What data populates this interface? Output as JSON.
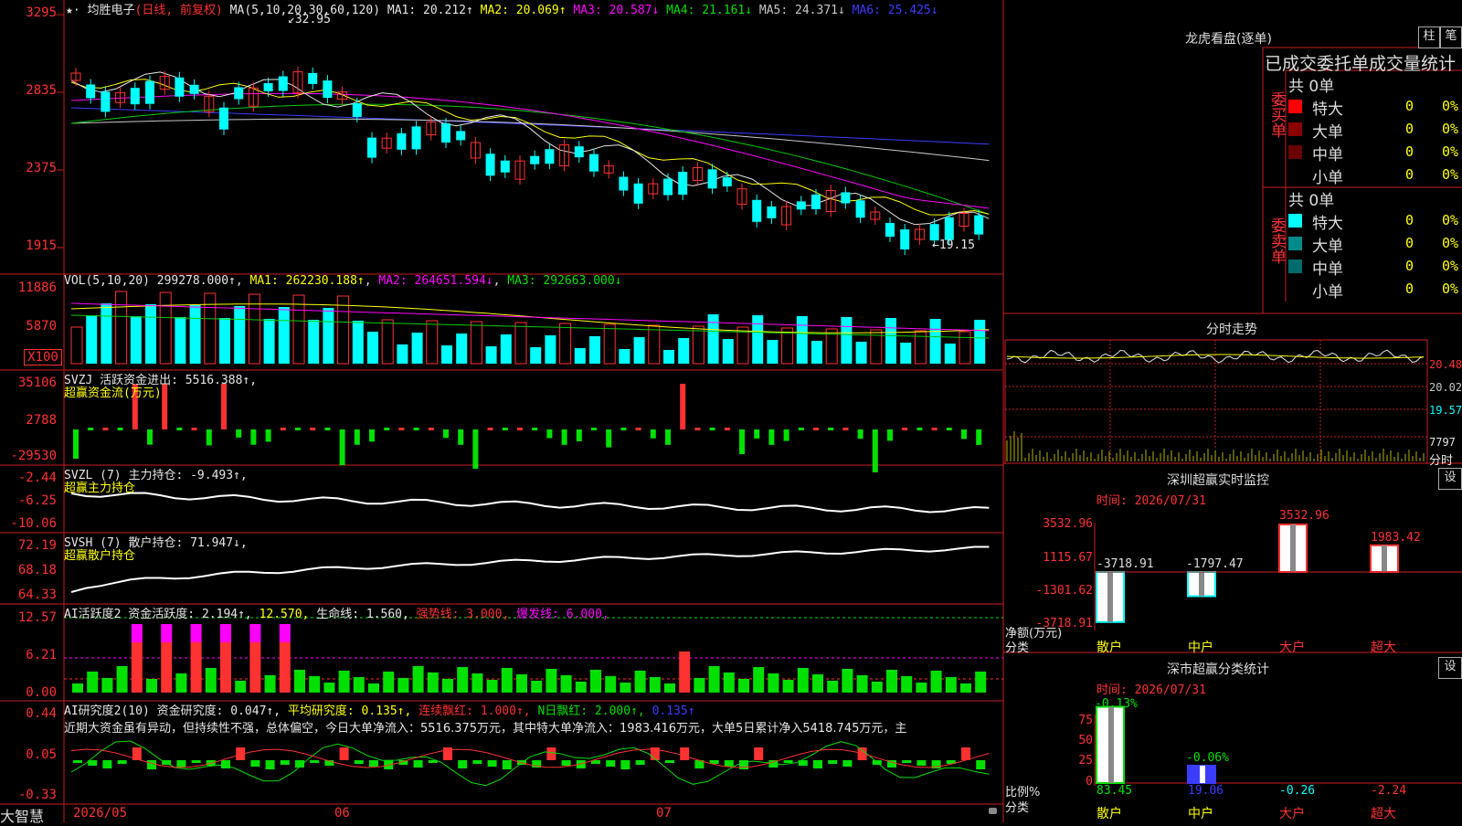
{
  "stock": {
    "name": "均胜电子",
    "period": "日线",
    "adjust": "前复权",
    "ma_label": "MA(5,10,20,30,60,120)",
    "ma1": "MA1: 20.212↑",
    "ma2": "MA2: 20.069↑",
    "ma3": "MA3: 20.587↓",
    "ma4": "MA4: 21.161↓",
    "ma5": "MA5: 24.371↓",
    "ma6": "MA6: 25.425↓",
    "high_mark": "32.95",
    "low_mark": "←19.15",
    "price_axis": [
      "3295",
      "2835",
      "2375",
      "1915"
    ]
  },
  "vol": {
    "label": "VOL(5,10,20)",
    "value": "299278.000↑",
    "ma1": "MA1: 262230.188↑",
    "ma2": "MA2: 264651.594↓",
    "ma3": "MA3: 292663.000↓",
    "axis": [
      "11886",
      "5870",
      "X100"
    ]
  },
  "svzj": {
    "label": "SVZJ  活跃资金进出: 5516.388↑,",
    "sub": "超赢资金流(万元)",
    "axis": [
      "35106",
      "2788",
      "-29530"
    ]
  },
  "svzl": {
    "label": "SVZL (7) 主力持仓: -9.493↑,",
    "sub": "超赢主力持仓",
    "axis": [
      "-2.44",
      "-6.25",
      "-10.06"
    ]
  },
  "svsh": {
    "label": "SVSH (7) 散户持仓: 71.947↓,",
    "sub": "超赢散户持仓",
    "axis": [
      "72.19",
      "68.18",
      "64.33"
    ]
  },
  "ai_active": {
    "label": "AI活跃度2 资金活跃度: 2.194↑,",
    "v1": "12.570,",
    "v2": "生命线: 1.560,",
    "v3": "强势线: 3.000,",
    "v4": "爆发线: 6.000,",
    "axis": [
      "12.57",
      "6.21",
      "0.00"
    ]
  },
  "ai_research": {
    "label": "AI研究度2(10) 资金研究度: 0.047↑,",
    "v1": "平均研究度: 0.135↑,",
    "v2": "连续飘红: 1.000↑,",
    "v3": "N日飘红: 2.000↑,",
    "v4": "0.135↑",
    "comment": "近期大资金虽有异动，但持续性不强，总体偏空，今日大单净流入：5516.375万元，其中特大单净流入：1983.416万元，大单5日累计净入5418.745万元，主",
    "axis": [
      "0.44",
      "0.05",
      "-0.33"
    ]
  },
  "date_axis": [
    "2026/05",
    "06",
    "07"
  ],
  "brand": "大智慧",
  "right": {
    "lhkp_title": "龙虎看盘(逐单)",
    "btn_zhu": "柱",
    "btn_bi": "笔",
    "lhkp_header": "已成交委托单成交量统计",
    "buy_side": "委买单",
    "sell_side": "委卖单",
    "buy_total": "共 0单",
    "sell_total": "共 0单",
    "buy_rows": [
      {
        "label": "特大",
        "count": "0",
        "pct": "0%",
        "color": "#ff0000"
      },
      {
        "label": "大单",
        "count": "0",
        "pct": "0%",
        "color": "#8b0000"
      },
      {
        "label": "中单",
        "count": "0",
        "pct": "0%",
        "color": "#6b0000"
      },
      {
        "label": "小单",
        "count": "0",
        "pct": "0%",
        "color": "#000000"
      }
    ],
    "sell_rows": [
      {
        "label": "特大",
        "count": "0",
        "pct": "0%",
        "color": "#00ffff"
      },
      {
        "label": "大单",
        "count": "0",
        "pct": "0%",
        "color": "#008b8b"
      },
      {
        "label": "中单",
        "count": "0",
        "pct": "0%",
        "color": "#006b6b"
      },
      {
        "label": "小单",
        "count": "0",
        "pct": "0%",
        "color": "#000000"
      }
    ],
    "fenshi_title": "分时走势",
    "fenshi_axis": [
      "20.48",
      "20.02",
      "19.57",
      "7797",
      "分时"
    ],
    "sz_monitor_title": "深圳超赢实时监控",
    "sz_time": "时间: 2026/07/31",
    "sz_axis": [
      "3532.96",
      "1115.67",
      "-1301.62",
      "-3718.91"
    ],
    "sz_values": [
      -3718.91,
      -1797.47,
      3532.96,
      1983.42
    ],
    "sz_value_labels": [
      "-3718.91",
      "-1797.47",
      "3532.96",
      "1983.42"
    ],
    "sz_ylabel": "净额(万元)",
    "sz_xlabel": "分类",
    "categories": [
      "散户",
      "中户",
      "大户",
      "超大"
    ],
    "btn_set": "设",
    "szs_title": "深市超赢分类统计",
    "szs_time": "时间: 2026/07/31",
    "szs_axis": [
      "75",
      "50",
      "25",
      "0"
    ],
    "szs_bar_labels": [
      "-0.13%",
      "-0.06%"
    ],
    "szs_bottom_values": [
      "83.45",
      "19.06",
      "-0.26",
      "-2.24"
    ],
    "szs_pct": [
      83.45,
      19.06
    ],
    "szs_ylabel": "比例%",
    "szs_xlabel": "分类"
  }
}
